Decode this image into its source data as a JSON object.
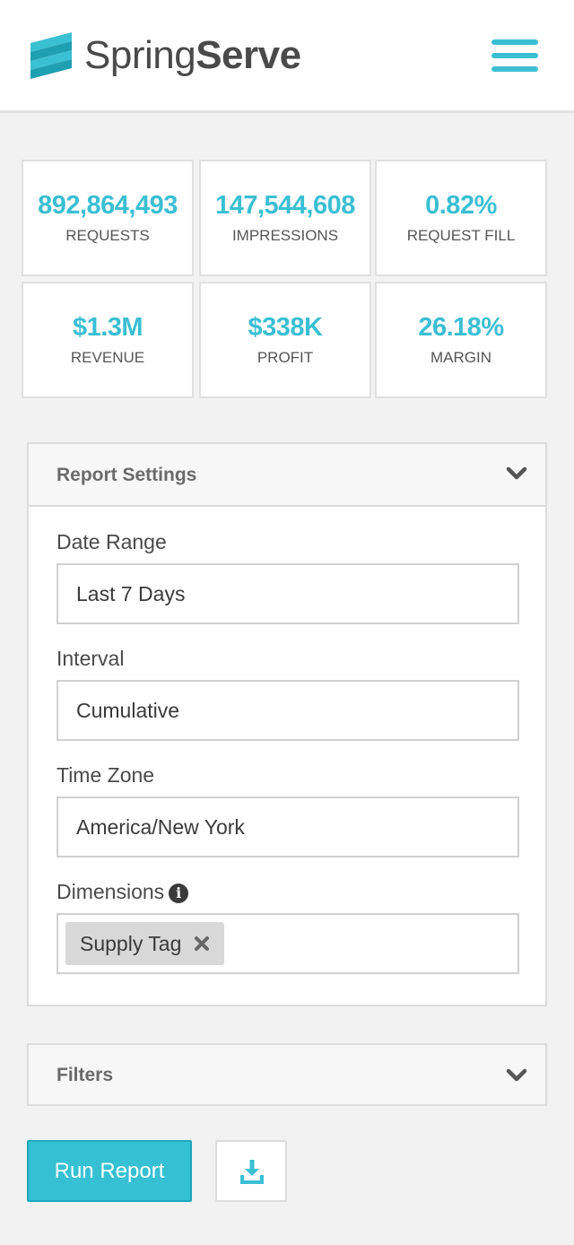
{
  "header": {
    "brand_light": "Spring",
    "brand_bold": "Serve",
    "logo_icon": "springserve-logo-icon",
    "menu_icon": "hamburger-menu-icon",
    "accent_color": "#3bbfd3"
  },
  "stats": [
    {
      "value": "892,864,493",
      "label": "REQUESTS"
    },
    {
      "value": "147,544,608",
      "label": "IMPRESSIONS"
    },
    {
      "value": "0.82%",
      "label": "REQUEST FILL"
    },
    {
      "value": "$1.3M",
      "label": "REVENUE"
    },
    {
      "value": "$338K",
      "label": "PROFIT"
    },
    {
      "value": "26.18%",
      "label": "MARGIN"
    }
  ],
  "report_settings": {
    "title": "Report Settings",
    "date_range": {
      "label": "Date Range",
      "value": "Last 7 Days"
    },
    "interval": {
      "label": "Interval",
      "value": "Cumulative"
    },
    "time_zone": {
      "label": "Time Zone",
      "value": "America/New York"
    },
    "dimensions": {
      "label": "Dimensions",
      "tags": [
        "Supply Tag"
      ]
    }
  },
  "filters": {
    "title": "Filters"
  },
  "actions": {
    "run_label": "Run Report",
    "download_icon": "download-icon"
  }
}
